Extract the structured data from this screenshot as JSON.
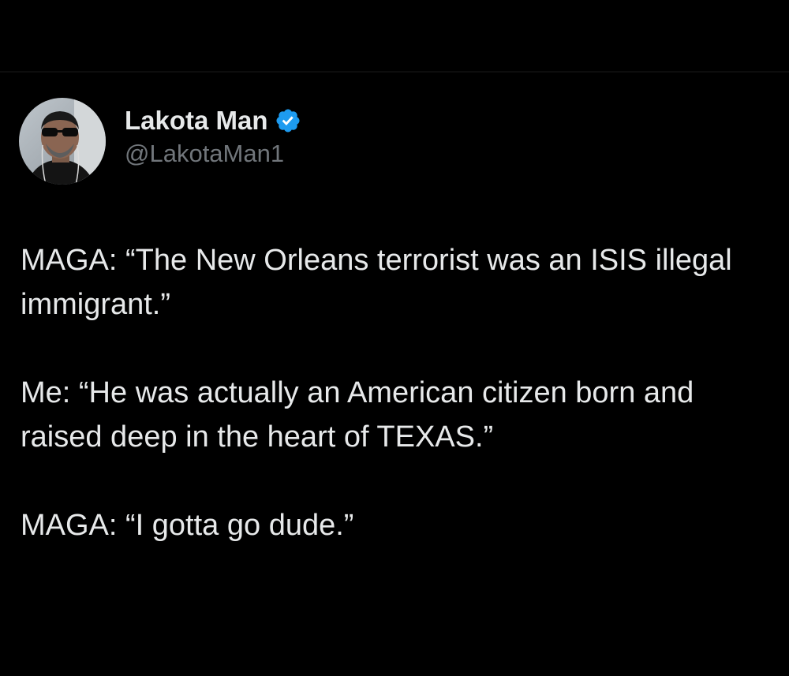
{
  "author": {
    "display_name": "Lakota Man",
    "handle": "@LakotaMan1",
    "verified": true,
    "verified_color": "#1d9bf0"
  },
  "tweet": {
    "paragraphs": [
      "MAGA: “The New Orleans terrorist was an ISIS illegal immigrant.”",
      "Me: “He was actually an American citizen born and raised deep in the heart of TEXAS.”",
      "MAGA: “I gotta go dude.”"
    ]
  },
  "icons": {
    "verified": "verified-badge-icon",
    "avatar": "profile-photo"
  },
  "colors": {
    "background": "#000000",
    "text_primary": "#e7e9ea",
    "text_secondary": "#71767b"
  }
}
